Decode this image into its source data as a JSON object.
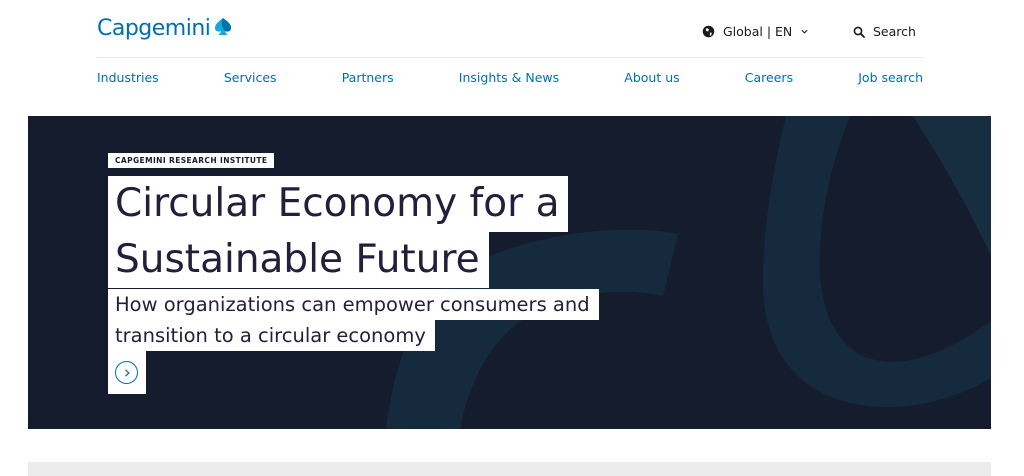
{
  "brand": {
    "name": "Capgemini",
    "color": "#0070ad"
  },
  "utility": {
    "region_label": "Global | EN",
    "search_label": "Search"
  },
  "nav": {
    "items": [
      {
        "label": "Industries"
      },
      {
        "label": "Services"
      },
      {
        "label": "Partners"
      },
      {
        "label": "Insights & News"
      },
      {
        "label": "About us"
      },
      {
        "label": "Careers"
      },
      {
        "label": "Job search"
      }
    ]
  },
  "hero": {
    "eyebrow": "CAPGEMINI RESEARCH INSTITUTE",
    "title_line1": "Circular Economy for a",
    "title_line2": "Sustainable Future",
    "subtitle_line1": "How organizations can empower consumers and",
    "subtitle_line2": "transition to a circular economy",
    "background_color": "#151c2e",
    "accent_color": "#0070ad"
  },
  "icons": {
    "globe": "globe-icon",
    "chevron": "chevron-down-icon",
    "search": "search-icon",
    "cta": "chevron-right-icon"
  }
}
